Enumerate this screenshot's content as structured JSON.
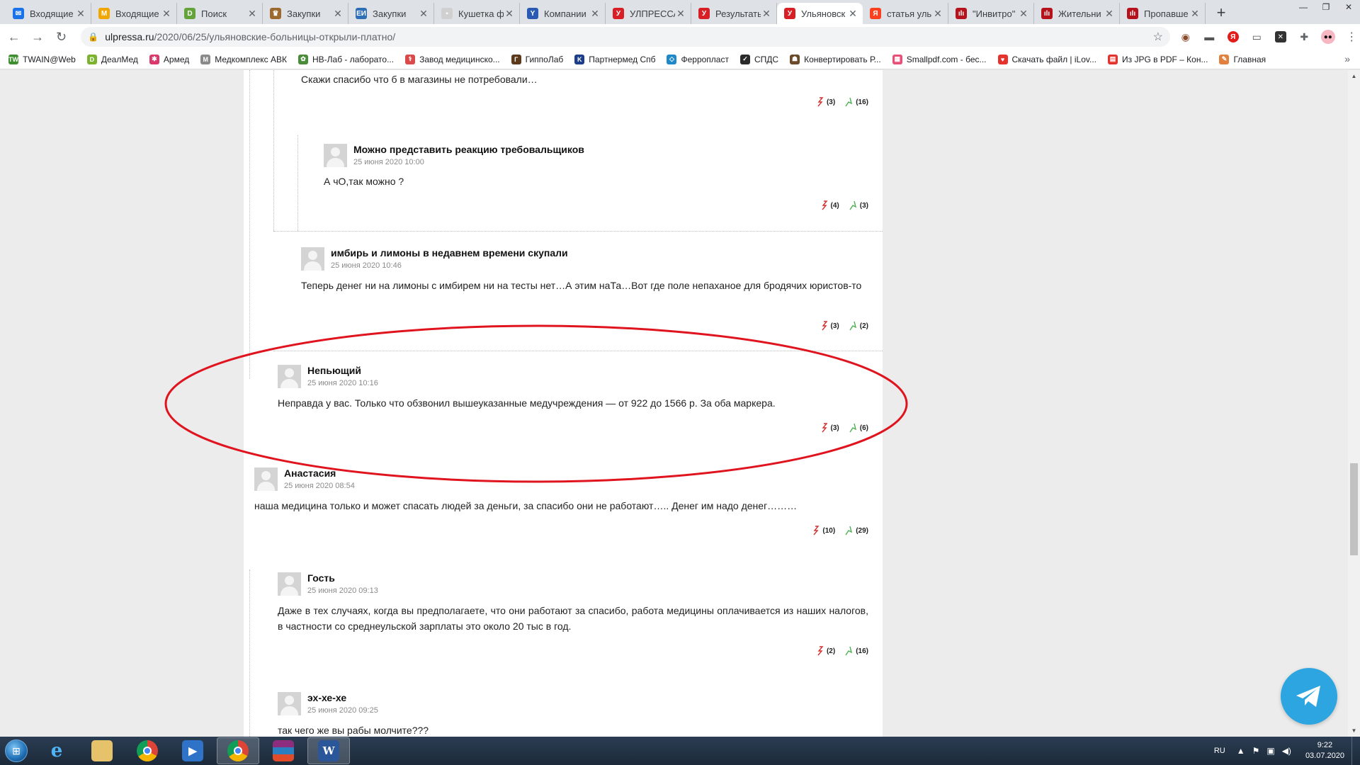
{
  "tabs": [
    {
      "title": "Входящие",
      "fav_color": "#1a73e8",
      "fav_glyph": "✉"
    },
    {
      "title": "Входящие",
      "fav_color": "#f2a600",
      "fav_glyph": "M"
    },
    {
      "title": "Поиск",
      "fav_color": "#63a33a",
      "fav_glyph": "D"
    },
    {
      "title": "Закупки",
      "fav_color": "#9c6a2e",
      "fav_glyph": "♛"
    },
    {
      "title": "Закупки",
      "fav_color": "#2d6eb5",
      "fav_glyph": "ЕИ"
    },
    {
      "title": "Кушетка ф",
      "fav_color": "#d0d0d0",
      "fav_glyph": "▪"
    },
    {
      "title": "Компании",
      "fav_color": "#2a5ab3",
      "fav_glyph": "Y"
    },
    {
      "title": "УЛПРЕССА",
      "fav_color": "#d81f26",
      "fav_glyph": "У"
    },
    {
      "title": "Результаты",
      "fav_color": "#d81f26",
      "fav_glyph": "У"
    },
    {
      "title": "Ульяновск",
      "fav_color": "#d81f26",
      "fav_glyph": "У",
      "active": true
    },
    {
      "title": "статья уль",
      "fav_color": "#fc3f1d",
      "fav_glyph": "Я"
    },
    {
      "title": "\"Инвитро\"",
      "fav_color": "#b5121b",
      "fav_glyph": "ılı"
    },
    {
      "title": "Жительни",
      "fav_color": "#b5121b",
      "fav_glyph": "ılı"
    },
    {
      "title": "Пропавше",
      "fav_color": "#b5121b",
      "fav_glyph": "ılı"
    }
  ],
  "url": {
    "host": "ulpressa.ru",
    "path": "/2020/06/25/ульяновские-больницы-открыли-платно/"
  },
  "bookmarks": [
    {
      "label": "TWAIN@Web",
      "color": "#3e8e2f",
      "glyph": "TW"
    },
    {
      "label": "ДеалМед",
      "color": "#7bb32e",
      "glyph": "D"
    },
    {
      "label": "Армед",
      "color": "#d93a6b",
      "glyph": "✱"
    },
    {
      "label": "Медкомплекс АВК",
      "color": "#8a8a8a",
      "glyph": "M"
    },
    {
      "label": "НВ-Лаб - лаборато...",
      "color": "#4a8c3a",
      "glyph": "✿"
    },
    {
      "label": "Завод медицинско...",
      "color": "#d94a4a",
      "glyph": "⚕"
    },
    {
      "label": "ГиппоЛаб",
      "color": "#5a3a1a",
      "glyph": "Г"
    },
    {
      "label": "Партнермед Спб",
      "color": "#1c3d8a",
      "glyph": "K"
    },
    {
      "label": "Ферропласт",
      "color": "#1e88c8",
      "glyph": "◇"
    },
    {
      "label": "СПДС",
      "color": "#2a2a2a",
      "glyph": "✓"
    },
    {
      "label": "Конвертировать Р...",
      "color": "#6b4a2a",
      "glyph": "☗"
    },
    {
      "label": "Smallpdf.com - бес...",
      "color": "#e94e77",
      "glyph": "▦"
    },
    {
      "label": "Скачать файл | iLov...",
      "color": "#e5322d",
      "glyph": "♥"
    },
    {
      "label": "Из JPG в PDF – Кон...",
      "color": "#e5322d",
      "glyph": "▤"
    },
    {
      "label": "Главная",
      "color": "#e2813d",
      "glyph": "✎"
    }
  ],
  "comments": [
    {
      "author": "",
      "date": "",
      "text": "Скажи спасибо что б в магазины не потребовали…",
      "down": "(3)",
      "up": "(16)"
    },
    {
      "author": "Можно представить реакцию требовальщиков",
      "date": "25 июня 2020 10:00",
      "text": "А чО,так можно ?",
      "down": "(4)",
      "up": "(3)"
    },
    {
      "author": "имбирь и лимоны в недавнем времени скупали",
      "date": "25 июня 2020 10:46",
      "text": "Теперь денег ни на лимоны с имбирем ни на тесты нет…А этим наТа…Вот где поле непаханое для бродячих юристов-то",
      "down": "(3)",
      "up": "(2)"
    },
    {
      "author": "Непьющий",
      "date": "25 июня 2020 10:16",
      "text": "Неправда у вас. Только что обзвонил вышеуказанные медучреждения — от 922 до 1566 р. За оба маркера.",
      "down": "(3)",
      "up": "(6)"
    },
    {
      "author": "Анастасия",
      "date": "25 июня 2020 08:54",
      "text": "наша медицина только и может спасать людей за деньги, за спасибо они не работают….. Денег им надо денег………",
      "down": "(10)",
      "up": "(29)"
    },
    {
      "author": "Гость",
      "date": "25 июня 2020 09:13",
      "text": "Даже в тех случаях, когда вы предполагаете, что они работают за спасибо, работа медицины оплачивается из наших налогов, в частности со среднеульской зарплаты это около 20 тыс в год.",
      "down": "(2)",
      "up": "(16)"
    },
    {
      "author": "эх-хе-хе",
      "date": "25 июня 2020 09:25",
      "text": "так чего же вы рабы молчите???",
      "down": "",
      "up": ""
    }
  ],
  "taskbar": {
    "lang": "RU",
    "time": "9:22",
    "date": "03.07.2020"
  },
  "colors": {
    "annotation": "#e0141e",
    "vote_down": "#d32f2f",
    "vote_up": "#4caf50"
  }
}
